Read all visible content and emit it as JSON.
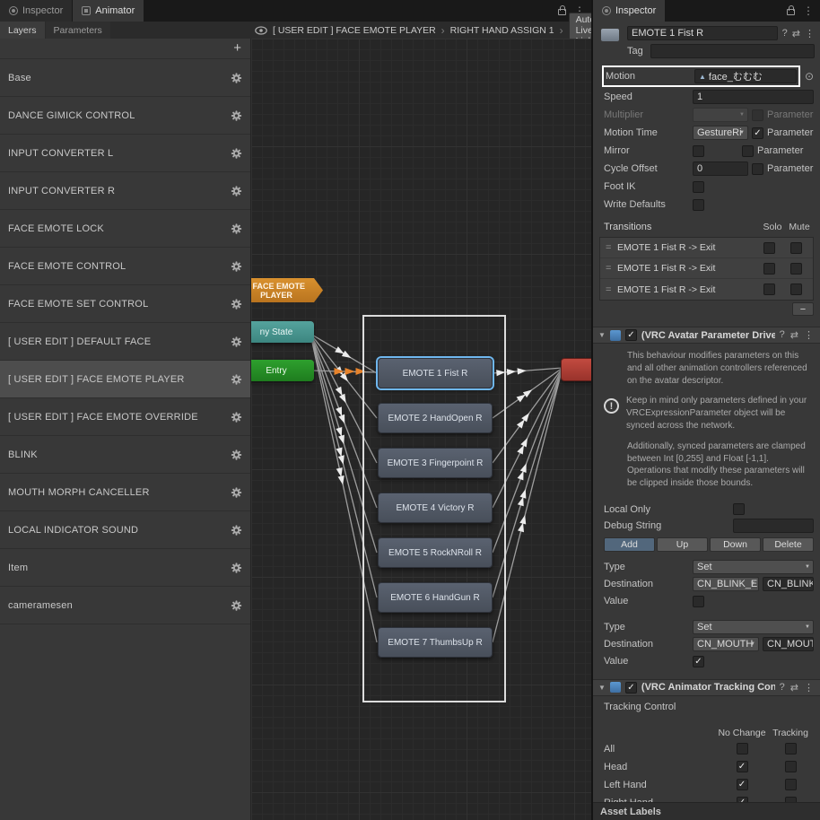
{
  "icons": {
    "kebab": "⋮",
    "plus": "+",
    "minus": "−",
    "foldout": "▼",
    "check": "✓",
    "object_picker": "⊙",
    "help": "?",
    "presets": "⇄",
    "motion_triangle": "▲",
    "breadcrumb_separator": "›",
    "drag_handle": "=",
    "info": "!"
  },
  "colors": {
    "selection_blue": "#6FB7EF",
    "entry_green": "#1E7C1E",
    "any_state_teal": "#3C8680",
    "substate_orange": "#C07A22",
    "exit_red": "#A93A30"
  },
  "window": {
    "left_tabs": [
      {
        "label": "Inspector"
      },
      {
        "label": "Animator"
      }
    ],
    "inspector_tab": "Inspector"
  },
  "layers_panel": {
    "tabs": [
      "Layers",
      "Parameters"
    ],
    "add_button": "+",
    "items": [
      {
        "label": "Base"
      },
      {
        "label": "DANCE GIMICK CONTROL"
      },
      {
        "label": "INPUT CONVERTER L"
      },
      {
        "label": "INPUT CONVERTER R"
      },
      {
        "label": "FACE EMOTE LOCK"
      },
      {
        "label": "FACE EMOTE CONTROL"
      },
      {
        "label": "FACE EMOTE SET CONTROL"
      },
      {
        "label": "[ USER EDIT ] DEFAULT FACE"
      },
      {
        "label": "[ USER EDIT ] FACE EMOTE PLAYER",
        "selected": true
      },
      {
        "label": "[ USER EDIT ] FACE EMOTE OVERRIDE"
      },
      {
        "label": "BLINK"
      },
      {
        "label": "MOUTH MORPH CANCELLER"
      },
      {
        "label": "LOCAL INDICATOR SOUND"
      },
      {
        "label": "Item"
      },
      {
        "label": "cameramesen"
      }
    ]
  },
  "breadcrumb": {
    "items": [
      "[ USER EDIT ] FACE EMOTE PLAYER",
      "RIGHT HAND ASSIGN 1"
    ],
    "auto_live_link": "Auto Live Link"
  },
  "graph": {
    "sub_state_machine": "] FACE EMOTE PLAYER",
    "any_state": "ny State",
    "entry": "Entry",
    "states": [
      {
        "label": "EMOTE 1 Fist R",
        "selected": true
      },
      {
        "label": "EMOTE 2 HandOpen R"
      },
      {
        "label": "EMOTE 3 Fingerpoint R"
      },
      {
        "label": "EMOTE 4 Victory R"
      },
      {
        "label": "EMOTE 5 RockNRoll R"
      },
      {
        "label": "EMOTE 6 HandGun R"
      },
      {
        "label": "EMOTE 7 ThumbsUp R"
      }
    ]
  },
  "inspector": {
    "title": "EMOTE 1 Fist R",
    "tag_label": "Tag",
    "tag_value": "",
    "motion": {
      "label": "Motion",
      "value": "face_むむむ"
    },
    "speed": {
      "label": "Speed",
      "value": "1"
    },
    "multiplier": {
      "label": "Multiplier",
      "value": "",
      "param": "Parameter",
      "param_checked": false
    },
    "motion_time": {
      "label": "Motion Time",
      "value": "GestureRi",
      "param": "Parameter",
      "param_checked": true
    },
    "mirror": {
      "label": "Mirror",
      "checked": false,
      "param": "Parameter",
      "param_checked": false
    },
    "cycle_offset": {
      "label": "Cycle Offset",
      "value": "0",
      "param": "Parameter",
      "param_checked": false
    },
    "foot_ik": {
      "label": "Foot IK",
      "checked": false
    },
    "write_defaults": {
      "label": "Write Defaults",
      "checked": false
    },
    "transitions": {
      "title": "Transitions",
      "solo": "Solo",
      "mute": "Mute",
      "rows": [
        {
          "label": "EMOTE 1 Fist R -> Exit",
          "solo": false,
          "mute": false
        },
        {
          "label": "EMOTE 1 Fist R -> Exit",
          "solo": false,
          "mute": false
        },
        {
          "label": "EMOTE 1 Fist R -> Exit",
          "solo": false,
          "mute": false
        }
      ],
      "remove_button": "−"
    },
    "param_driver": {
      "title": "(VRC Avatar Parameter Driver",
      "enabled": true,
      "desc1": "This behaviour modifies parameters on this and all other animation controllers referenced on the avatar descriptor.",
      "desc2": "Keep in mind only parameters defined in your VRCExpressionParameter object will be synced across the network.",
      "desc3": "Additionally, synced parameters are clamped between Int [0,255] and Float [-1,1]. Operations that modify these parameters will be clipped inside those bounds.",
      "local_only": "Local Only",
      "local_only_checked": false,
      "debug_string": "Debug String",
      "debug_value": "",
      "buttons": [
        {
          "label": "Add",
          "primary": true
        },
        {
          "label": "Up"
        },
        {
          "label": "Down"
        },
        {
          "label": "Delete"
        }
      ],
      "entries": [
        {
          "type_label": "Type",
          "type_value": "Set",
          "dest_label": "Destination",
          "dest_dropdown": "CN_BLINK_E",
          "dest_value": "CN_BLINK_EN",
          "value_label": "Value",
          "value_checked": false
        },
        {
          "type_label": "Type",
          "type_value": "Set",
          "dest_label": "Destination",
          "dest_dropdown": "CN_MOUTH",
          "dest_value": "CN_MOUTH_M",
          "value_label": "Value",
          "value_checked": true
        }
      ]
    },
    "tracking": {
      "title": "(VRC Animator Tracking Contr",
      "enabled": true,
      "subtitle": "Tracking Control",
      "col1": "No Change",
      "col2": "Tracking",
      "rows": [
        {
          "label": "All",
          "no_change": false,
          "tracking": false
        },
        {
          "label": "Head",
          "no_change": true,
          "tracking": false
        },
        {
          "label": "Left Hand",
          "no_change": true,
          "tracking": false
        },
        {
          "label": "Right Hand",
          "no_change": true,
          "tracking": false
        }
      ]
    },
    "asset_labels": "Asset Labels"
  }
}
